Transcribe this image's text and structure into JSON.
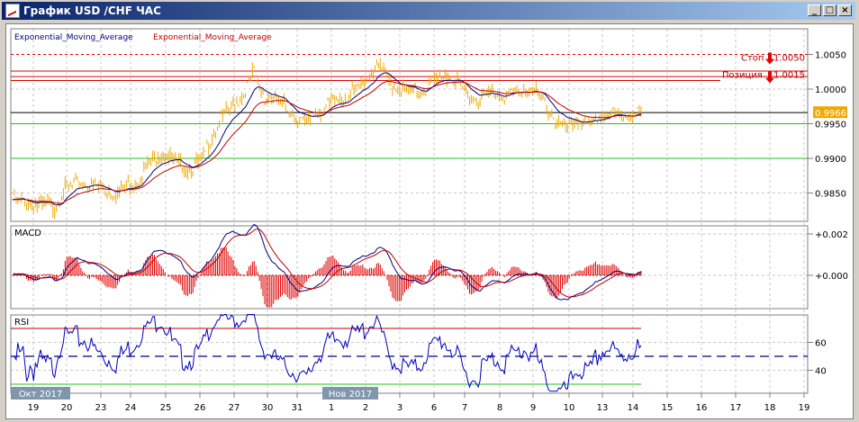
{
  "window": {
    "title": "График USD /CHF  ЧАС",
    "minimize": "_",
    "maximize": "□",
    "close": "×"
  },
  "legend": {
    "ema_fast": "Exponential_Moving_Average",
    "ema_slow": "Exponential_Moving_Average"
  },
  "panels": {
    "macd": "MACD",
    "rsi": "RSI"
  },
  "chart_data": {
    "type": "line",
    "title": "График USD /CHF  ЧАС",
    "symbol": "USD/CHF",
    "timeframe": "ЧАС",
    "price_ticks": [
      "1.0050",
      "1.0000",
      "0.9950",
      "0.9900",
      "0.9850"
    ],
    "price_tick_values": [
      1.005,
      1.0,
      0.995,
      0.99,
      0.985
    ],
    "macd_ticks": [
      "+0.002",
      "+0.000"
    ],
    "macd_tick_values": [
      0.002,
      0.0
    ],
    "rsi_ticks": [
      "60",
      "40"
    ],
    "rsi_tick_values": [
      60,
      40
    ],
    "rsi_levels": {
      "overbought": 70,
      "middle": 50,
      "oversold": 30
    },
    "dates": [
      "19",
      "20",
      "23",
      "24",
      "25",
      "26",
      "27",
      "30",
      "31",
      "1",
      "2",
      "3",
      "6",
      "7",
      "8",
      "9",
      "10",
      "13",
      "14",
      "15",
      "16",
      "17",
      "18",
      "19"
    ],
    "months": [
      {
        "label": "Окт 2017",
        "date_index": 0
      },
      {
        "label": "Нов 2017",
        "date_index": 9
      }
    ],
    "price": [
      0.984,
      0.9838,
      0.9835,
      0.9832,
      0.983,
      0.9855,
      0.9862,
      0.9865,
      0.986,
      0.9855,
      0.985,
      0.986,
      0.987,
      0.989,
      0.991,
      0.99,
      0.989,
      0.9885,
      0.9895,
      0.993,
      0.996,
      0.9975,
      0.999,
      1.0025,
      0.999,
      0.9985,
      0.9975,
      0.996,
      0.995,
      0.9965,
      0.9975,
      0.9985,
      0.999,
      1.0,
      1.002,
      1.0035,
      1.001,
      1.0,
      0.9995,
      0.9995,
      1.001,
      1.002,
      1.0015,
      1.0,
      0.9985,
      0.999,
      0.9995,
      0.999,
      0.9995,
      1.0,
      0.9995,
      0.9975,
      0.995,
      0.9945,
      0.9955,
      0.9945,
      0.996,
      0.9965,
      0.996,
      0.9965,
      0.9966
    ],
    "current_price": "0.9966",
    "current_price_value": 0.9966,
    "levels": {
      "stop": {
        "label": "Стоп",
        "value": "1.0050",
        "num": 1.005
      },
      "position": {
        "label": "Позиция",
        "value": "1.0015",
        "num": 1.0015
      }
    },
    "red_lines": [
      1.0026,
      1.0018
    ],
    "green_lines": [
      0.995,
      0.99
    ],
    "ylim": [
      0.9811,
      1.0088
    ]
  },
  "colors": {
    "price": "#f0a800",
    "ema_fast": "#000080",
    "ema_slow": "#c00000",
    "stop": "#e00000",
    "green": "#20c020",
    "badge": "#f0a800",
    "month_badge": "#8096ad"
  }
}
